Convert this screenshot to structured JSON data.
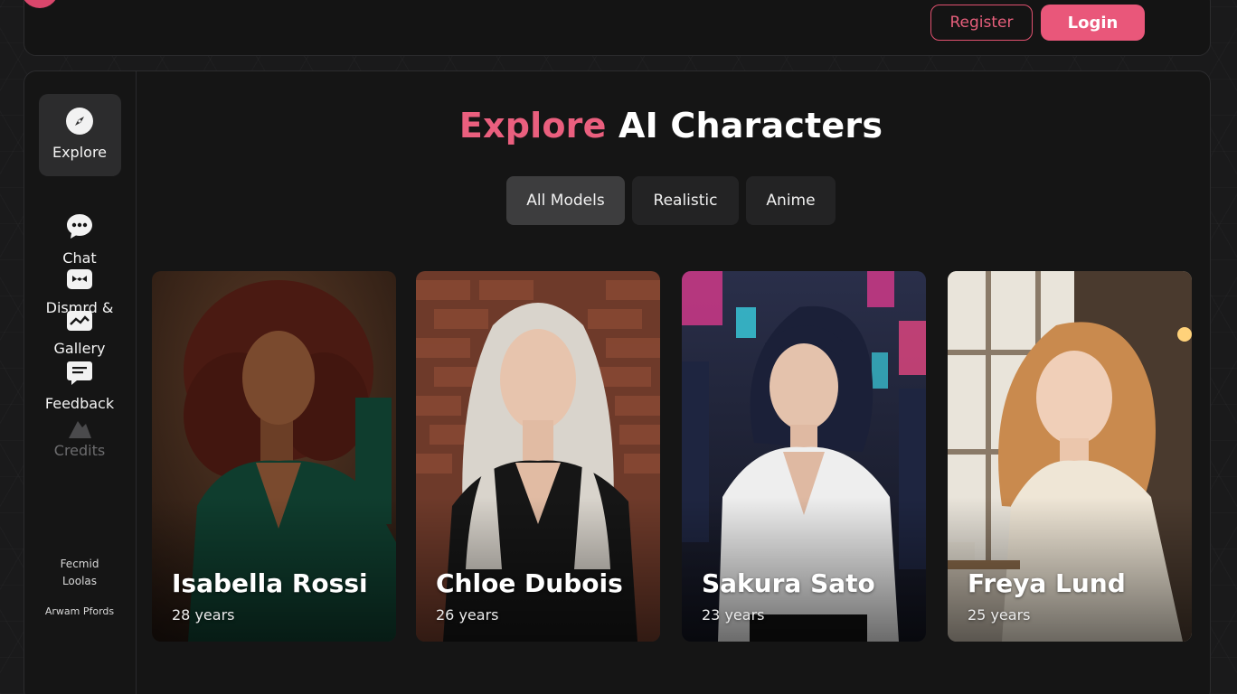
{
  "header": {
    "register_label": "Register",
    "login_label": "Login"
  },
  "sidebar": {
    "items": [
      {
        "label": "Explore",
        "icon": "compass-icon",
        "active": true
      },
      {
        "label": "Chat",
        "icon": "chat-bubble-icon"
      },
      {
        "label": "Dismrd &",
        "icon": "discord-icon"
      },
      {
        "label": "Gallery",
        "icon": "image-icon"
      },
      {
        "label": "Feedback",
        "icon": "message-square-icon"
      },
      {
        "label": "Credits",
        "icon": "credits-icon",
        "dimmed": true
      }
    ],
    "footer_links": [
      "Fecmid",
      "Loolas",
      "Arwam Pfords"
    ]
  },
  "main": {
    "title_accent": "Explore",
    "title_rest": "AI Characters",
    "filters": [
      {
        "label": "All Models",
        "active": true
      },
      {
        "label": "Realistic"
      },
      {
        "label": "Anime"
      }
    ],
    "characters": [
      {
        "name": "Isabella Rossi",
        "age": "28 years"
      },
      {
        "name": "Chloe Dubois",
        "age": "26 years"
      },
      {
        "name": "Sakura Sato",
        "age": "23 years"
      },
      {
        "name": "Freya Lund",
        "age": "25 years"
      }
    ]
  },
  "colors": {
    "accent": "#ea5f7e",
    "login_bg": "#e9577a",
    "background": "#1a1a1b",
    "panel": "#151515",
    "tab_active": "#3d3d3e",
    "tab": "#232324"
  }
}
